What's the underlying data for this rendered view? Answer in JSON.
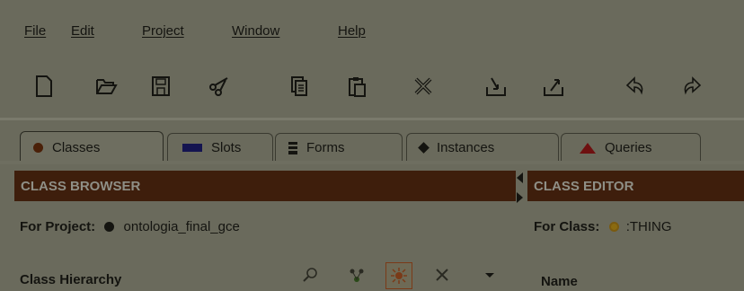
{
  "menu": {
    "file": "File",
    "edit": "Edit",
    "project": "Project",
    "window": "Window",
    "help": "Help"
  },
  "toolbar": {
    "buttons": [
      "new-file-icon",
      "open-folder-icon",
      "save-icon",
      "cut-icon",
      "copy-icon",
      "paste-icon",
      "delete-icon",
      "import-icon",
      "export-icon",
      "undo-icon",
      "redo-icon"
    ]
  },
  "tabs": [
    {
      "label": "Classes",
      "icon": "classes-icon",
      "active": true
    },
    {
      "label": "Slots",
      "icon": "slots-icon"
    },
    {
      "label": "Forms",
      "icon": "forms-icon"
    },
    {
      "label": "Instances",
      "icon": "instances-icon"
    },
    {
      "label": "Queries",
      "icon": "queries-icon"
    }
  ],
  "class_browser": {
    "header": "CLASS BROWSER",
    "project_label": "For Project:",
    "project_name": "ontologia_final_gce",
    "hierarchy_label": "Class Hierarchy"
  },
  "class_editor": {
    "header": "CLASS EDITOR",
    "class_label": "For Class:",
    "class_name": ":THING",
    "name_label": "Name"
  },
  "colors": {
    "background": "#6a6a5c",
    "header_bg": "#3e1e0c",
    "header_text": "#8f8f86",
    "classes_dot": "#4a2008",
    "slots_icon": "#141450",
    "queries_icon": "#6e1010",
    "class_dot": "#8a6a10",
    "highlight": "#7a3a18"
  }
}
